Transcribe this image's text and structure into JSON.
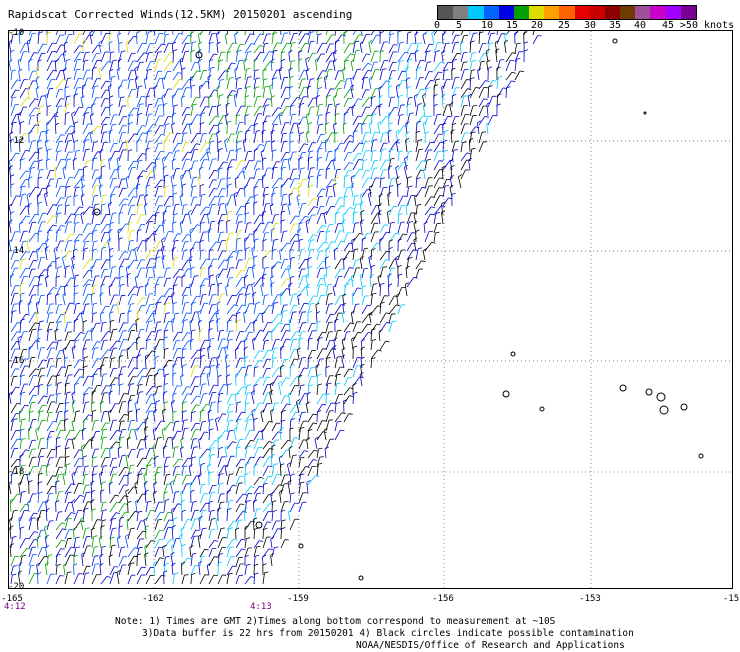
{
  "title": "Rapidscat Corrected Winds(12.5KM) 20150201 ascending",
  "wind_scale": {
    "labels": [
      "0",
      "5",
      "10",
      "15",
      "20",
      "25",
      "30",
      "35",
      "40",
      "45",
      ">50 knots"
    ],
    "colors": [
      "#555555",
      "#7f7f7f",
      "#00c8ff",
      "#0064ff",
      "#0000e6",
      "#00a000",
      "#dcdc00",
      "#ffa000",
      "#ff6400",
      "#e60000",
      "#c80000",
      "#8c0000",
      "#6e3c00",
      "#a0509b",
      "#c800c8",
      "#a000ff",
      "#780096"
    ]
  },
  "axes": {
    "y_labels": [
      "-10",
      "-12",
      "-14",
      "-16",
      "-18",
      "-20"
    ],
    "x_labels": [
      "-165",
      "-162",
      "-159",
      "-156",
      "-153",
      "-15"
    ]
  },
  "times": [
    "4:12",
    "4:13"
  ],
  "notes": [
    "Note: 1) Times are GMT 2)Times along bottom correspond to measurement at ~10S",
    "3)Data buffer is 22 hrs from 20150201 4) Black circles indicate possible contamination",
    "NOAA/NESDIS/Office of Research and Applications"
  ],
  "colors": {
    "rain_flag": "#000000",
    "background": "#ffffff",
    "grid": "#888888"
  }
}
